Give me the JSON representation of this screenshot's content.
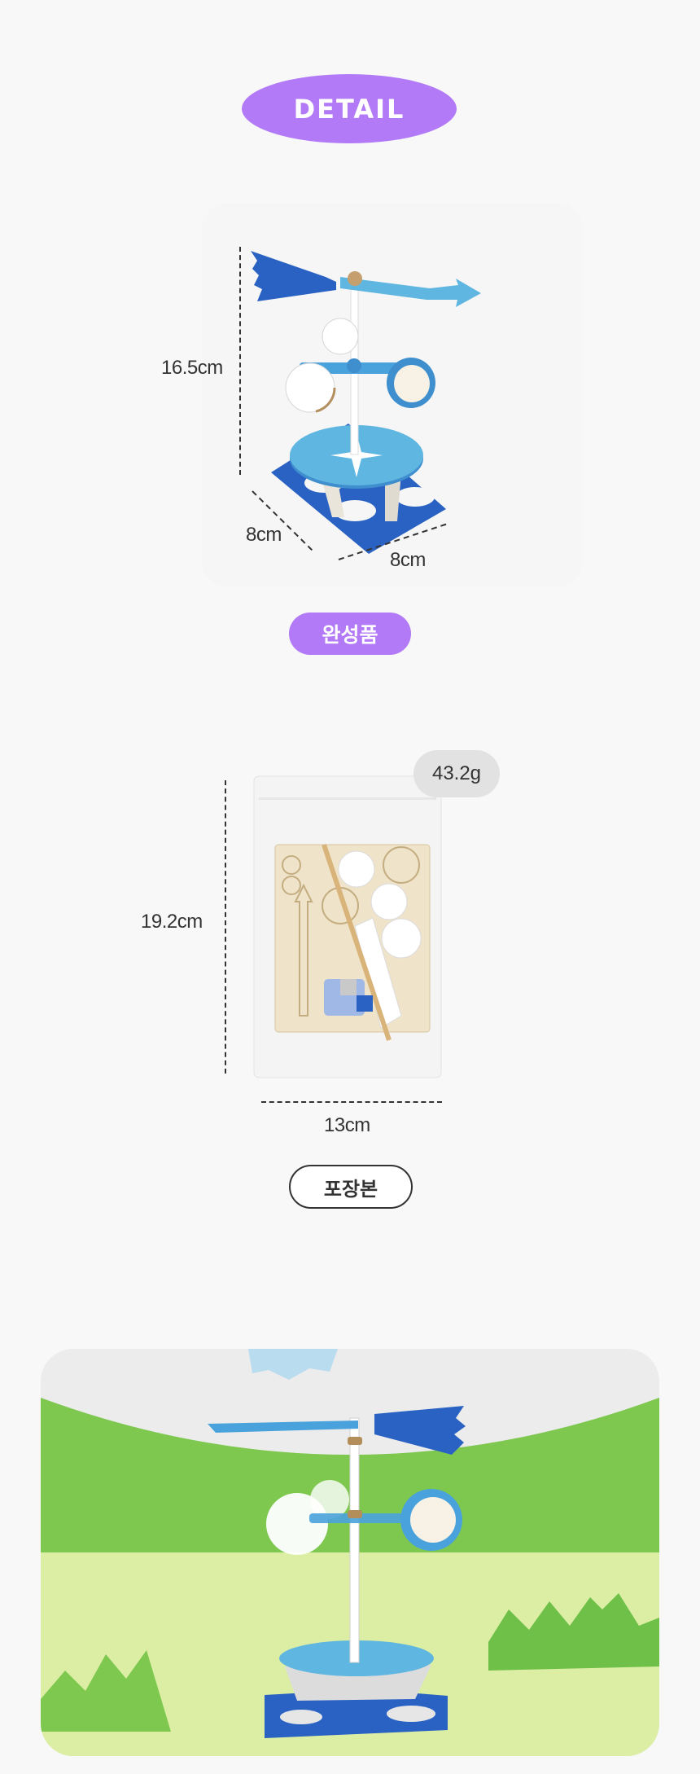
{
  "header": {
    "detail_label": "DETAIL"
  },
  "finished_product": {
    "height_label": "16.5cm",
    "depth_label": "8cm",
    "width_label": "8cm",
    "caption": "완성품",
    "caption_color": "#b27af7"
  },
  "package": {
    "weight_label": "43.2g",
    "height_label": "19.2cm",
    "width_label": "13cm",
    "caption": "포장본"
  },
  "colors": {
    "accent_purple": "#b27af7",
    "vane_blue": "#2a62c4",
    "light_blue": "#5fb6e0",
    "grass_green": "#7ec850",
    "ground_lime": "#dbeea4"
  }
}
